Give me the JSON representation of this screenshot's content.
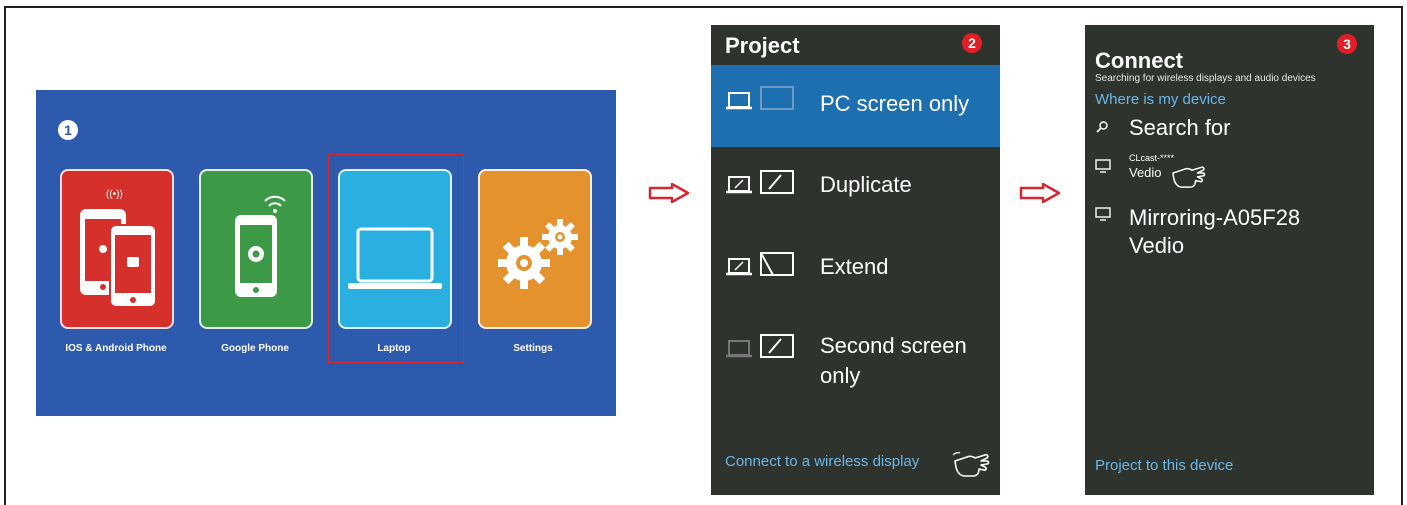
{
  "step1": {
    "badge": "1",
    "tiles": [
      {
        "label": "IOS & Android Phone",
        "color": "#d5302c",
        "icon": "phones-icon"
      },
      {
        "label": "Google Phone",
        "color": "#3c9a46",
        "icon": "android-phone-icon"
      },
      {
        "label": "Laptop",
        "color": "#2ab0e0",
        "icon": "laptop-icon"
      },
      {
        "label": "Settings",
        "color": "#e4922d",
        "icon": "gears-icon"
      }
    ],
    "background": "#2d5aac"
  },
  "step2": {
    "title": "Project",
    "badge": "2",
    "options": [
      {
        "label": "PC screen only",
        "icon": "pc-screen-only-icon",
        "selected": true
      },
      {
        "label": "Duplicate",
        "icon": "duplicate-icon",
        "selected": false
      },
      {
        "label": "Extend",
        "icon": "extend-icon",
        "selected": false
      },
      {
        "label_line1": "Second screen",
        "label_line2": "only",
        "icon": "second-screen-only-icon",
        "selected": false
      }
    ],
    "link": "Connect to a wireless display",
    "accent": "#1e6fb0",
    "link_color": "#6bb7e8"
  },
  "step3": {
    "title": "Connect",
    "badge": "3",
    "subtitle": "Searching for wireless displays and audio devices",
    "where": "Where is my device",
    "search": "Search for",
    "devices": [
      {
        "name": "CLcast-****",
        "sub": "Vedio",
        "icon": "monitor-icon"
      },
      {
        "name": "Mirroring-A05F28",
        "sub": "Vedio",
        "icon": "monitor-icon"
      }
    ],
    "link": "Project to this device"
  }
}
